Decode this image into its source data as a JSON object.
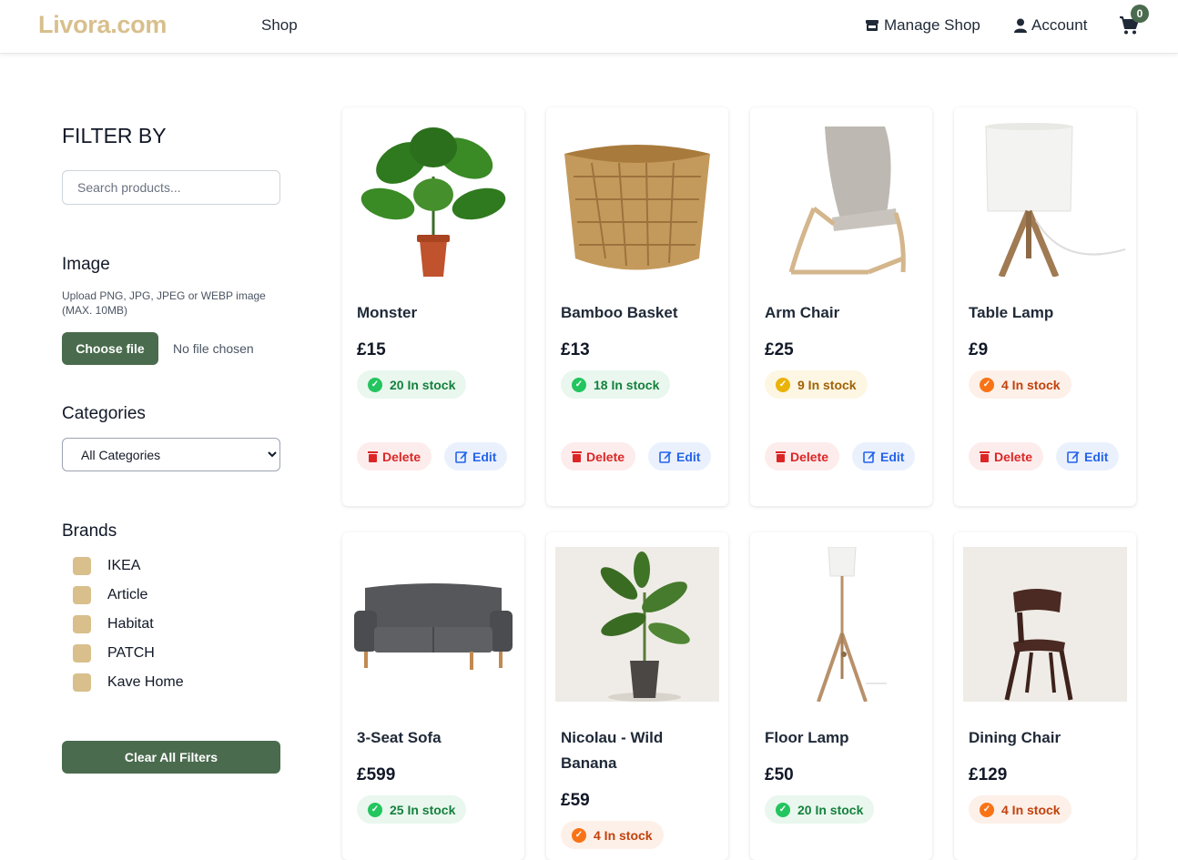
{
  "header": {
    "logo": "Livora.com",
    "nav_shop": "Shop",
    "nav_manage": "Manage Shop",
    "nav_account": "Account",
    "cart_count": "0"
  },
  "sidebar": {
    "filter_title": "FILTER BY",
    "search_placeholder": "Search products...",
    "image_title": "Image",
    "upload_hint": "Upload PNG, JPG, JPEG or WEBP image (MAX. 10MB)",
    "choose_file": "Choose file",
    "no_file": "No file chosen",
    "categories_title": "Categories",
    "category_selected": "All Categories",
    "brands_title": "Brands",
    "brands": [
      "IKEA",
      "Article",
      "Habitat",
      "PATCH",
      "Kave Home"
    ],
    "clear_filters": "Clear All Filters"
  },
  "products": [
    {
      "name": "Monster",
      "price": "£15",
      "stock": "20 In stock",
      "stock_level": "green"
    },
    {
      "name": "Bamboo Basket",
      "price": "£13",
      "stock": "18 In stock",
      "stock_level": "green"
    },
    {
      "name": "Arm Chair",
      "price": "£25",
      "stock": "9 In stock",
      "stock_level": "yellow"
    },
    {
      "name": "Table Lamp",
      "price": "£9",
      "stock": "4 In stock",
      "stock_level": "orange"
    },
    {
      "name": "3-Seat Sofa",
      "price": "£599",
      "stock": "25 In stock",
      "stock_level": "green"
    },
    {
      "name": "Nicolau - Wild Banana",
      "price": "£59",
      "stock": "4 In stock",
      "stock_level": "orange"
    },
    {
      "name": "Floor Lamp",
      "price": "£50",
      "stock": "20 In stock",
      "stock_level": "green"
    },
    {
      "name": "Dining Chair",
      "price": "£129",
      "stock": "4 In stock",
      "stock_level": "orange"
    }
  ],
  "actions": {
    "delete": "Delete",
    "edit": "Edit"
  },
  "colors": {
    "brand": "#4a6b4e",
    "logo": "#d8bf8c",
    "delete": "#dc2626",
    "edit": "#2563eb"
  },
  "icons": {
    "manage": "store-icon",
    "account": "user-icon",
    "cart": "cart-icon",
    "stock": "check-circle-icon",
    "delete": "trash-icon",
    "edit": "edit-icon"
  }
}
